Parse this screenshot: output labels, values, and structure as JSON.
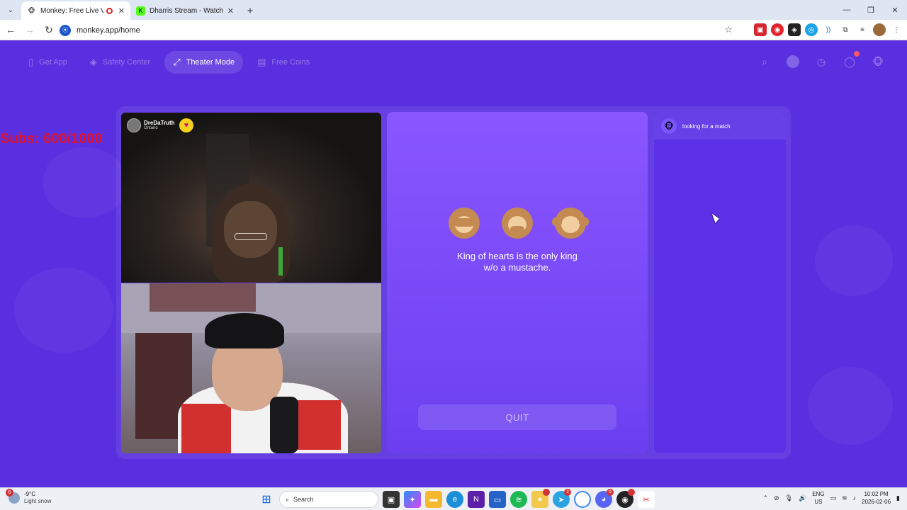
{
  "browser": {
    "tabs": [
      {
        "title": "Monkey: Free Live Video Ch",
        "active": true,
        "recording": true
      },
      {
        "title": "Dharris Stream - Watch Live on",
        "active": false,
        "recording": false
      }
    ],
    "url": "monkey.app/home"
  },
  "nav": {
    "get_app": "Get App",
    "safety_center": "Safety Center",
    "theater_mode": "Theater Mode",
    "free_coins": "Free Coins"
  },
  "overlay": {
    "subs": "Subs: 600/1000"
  },
  "video_top": {
    "username": "DreDaTruth",
    "location": "Ontario"
  },
  "middle": {
    "emojis": [
      "see-no-evil-monkey",
      "speak-no-evil-monkey",
      "hear-no-evil-monkey"
    ],
    "fact_line1": "King of hearts is the only king",
    "fact_line2": "w/o a mustache.",
    "quit_label": "QUIT"
  },
  "right_panel": {
    "status": "looking for a match"
  },
  "taskbar": {
    "weather_badge": "6",
    "weather_temp": "-9°C",
    "weather_desc": "Light snow",
    "search_label": "Search",
    "lang1": "ENG",
    "lang2": "US",
    "time": "10:02 PM",
    "date": "2026-02-06",
    "telegram_badge": "3",
    "discord_badge": "9"
  },
  "colors": {
    "page_bg": "#5a2fe0",
    "mid_panel": "#8a56ff",
    "subs_text": "#e0122c"
  }
}
